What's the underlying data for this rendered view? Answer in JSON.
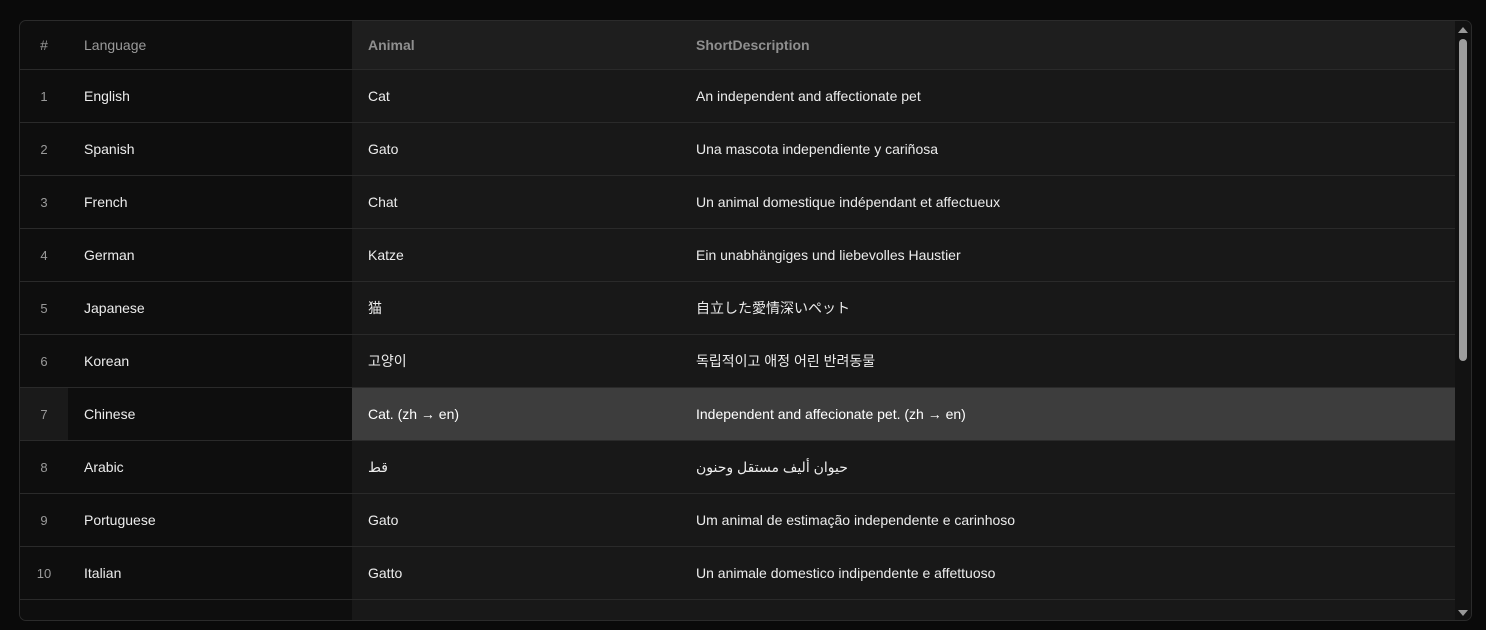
{
  "grid": {
    "columns": [
      "#",
      "Language",
      "Animal",
      "ShortDescription"
    ],
    "rows": [
      {
        "index": "1",
        "language": "English",
        "animal": "Cat",
        "description": "An independent and affectionate pet"
      },
      {
        "index": "2",
        "language": "Spanish",
        "animal": "Gato",
        "description": "Una mascota independiente y cariñosa"
      },
      {
        "index": "3",
        "language": "French",
        "animal": "Chat",
        "description": "Un animal domestique indépendant et affectueux"
      },
      {
        "index": "4",
        "language": "German",
        "animal": "Katze",
        "description": "Ein unabhängiges und liebevolles Haustier"
      },
      {
        "index": "5",
        "language": "Japanese",
        "animal": "猫",
        "description": "自立した愛情深いペット"
      },
      {
        "index": "6",
        "language": "Korean",
        "animal": "고양이",
        "description": "독립적이고 애정 어린 반려동물"
      },
      {
        "index": "7",
        "language": "Chinese",
        "animal": "Cat. (zh → en)",
        "description": "Independent and affecionate pet. (zh → en)"
      },
      {
        "index": "8",
        "language": "Arabic",
        "animal": "قط",
        "description": "حيوان أليف مستقل وحنون"
      },
      {
        "index": "9",
        "language": "Portuguese",
        "animal": "Gato",
        "description": "Um animal de estimação independente e carinhoso"
      },
      {
        "index": "10",
        "language": "Italian",
        "animal": "Gatto",
        "description": "Un animale domestico indipendente e affettuoso"
      }
    ],
    "selected_row": "7"
  },
  "colors": {
    "background": "#0a0a0a",
    "selected_row": "#3d3d3d",
    "header_text": "#8f8f8f",
    "cell_text": "#ececec"
  }
}
